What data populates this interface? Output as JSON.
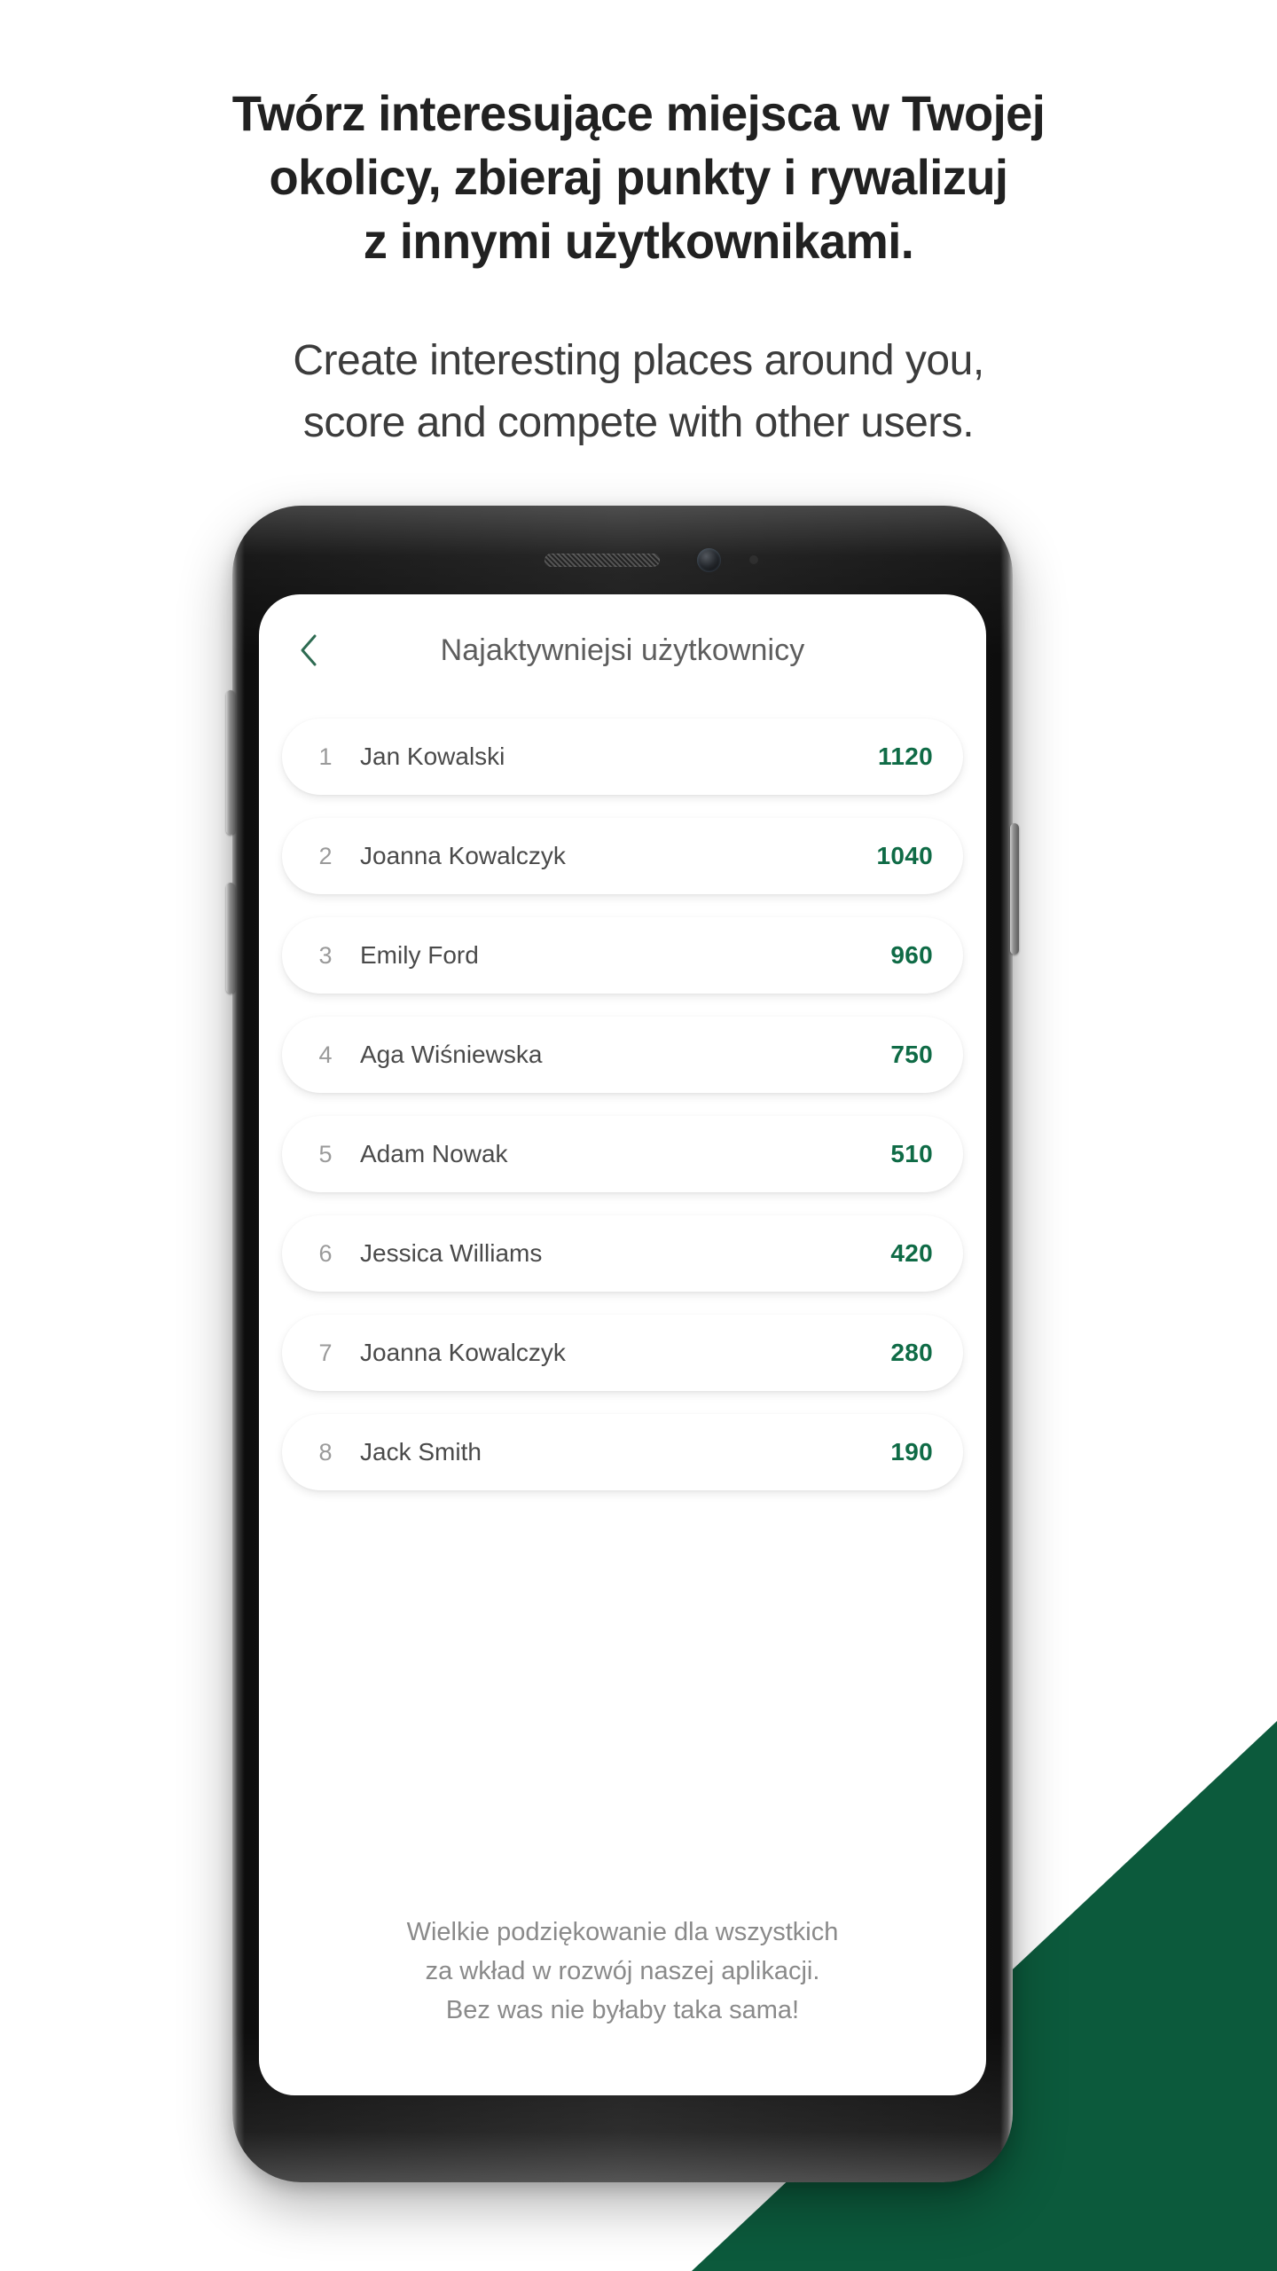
{
  "promo": {
    "headline_lines": [
      "Twórz interesujące miejsca w Twojej",
      "okolicy, zbieraj punkty i rywalizuj",
      "z innymi użytkownikami."
    ],
    "subhead_lines": [
      "Create interesting places around you,",
      "score and compete with other users."
    ]
  },
  "app": {
    "header": {
      "back_icon": "chevron-left-icon",
      "title": "Najaktywniejsi użytkownicy"
    },
    "leaderboard": [
      {
        "rank": "1",
        "name": "Jan Kowalski",
        "score": "1120"
      },
      {
        "rank": "2",
        "name": "Joanna Kowalczyk",
        "score": "1040"
      },
      {
        "rank": "3",
        "name": "Emily Ford",
        "score": "960"
      },
      {
        "rank": "4",
        "name": "Aga Wiśniewska",
        "score": "750"
      },
      {
        "rank": "5",
        "name": "Adam Nowak",
        "score": "510"
      },
      {
        "rank": "6",
        "name": "Jessica Williams",
        "score": "420"
      },
      {
        "rank": "7",
        "name": "Joanna Kowalczyk",
        "score": "280"
      },
      {
        "rank": "8",
        "name": "Jack Smith",
        "score": "190"
      }
    ],
    "footer_lines": [
      "Wielkie podziękowanie dla wszystkich",
      "za wkład w rozwój naszej aplikacji.",
      "Bez was nie byłaby taka sama!"
    ]
  },
  "device": {
    "earpiece_icon": "speaker-grille-icon",
    "front_camera_icon": "front-camera-icon",
    "sensor_icon": "proximity-sensor-icon",
    "buttons": [
      "bixby-button",
      "volume-down-button",
      "power-button"
    ]
  },
  "colors": {
    "accent_green": "#0f6b46",
    "wedge_green": "#0c5a3c",
    "headline": "#212121",
    "subhead": "#3c3c3c",
    "muted": "#8a8a8a"
  }
}
